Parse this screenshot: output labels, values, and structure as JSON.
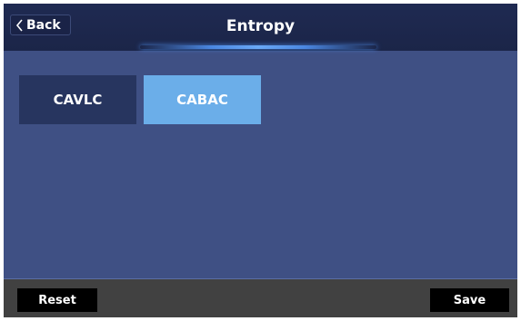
{
  "header": {
    "back_label": "Back",
    "title": "Entropy",
    "back_icon": "chevron-left-icon"
  },
  "options": [
    {
      "label": "CAVLC",
      "selected": false
    },
    {
      "label": "CABAC",
      "selected": true
    }
  ],
  "footer": {
    "reset_label": "Reset",
    "save_label": "Save"
  },
  "colors": {
    "background": "#3f5084",
    "header": "#1f2a52",
    "option_unselected": "#27355f",
    "option_selected": "#6baee9",
    "footer": "#414141",
    "footer_button": "#000000",
    "accent_glow": "#4a86e0"
  }
}
